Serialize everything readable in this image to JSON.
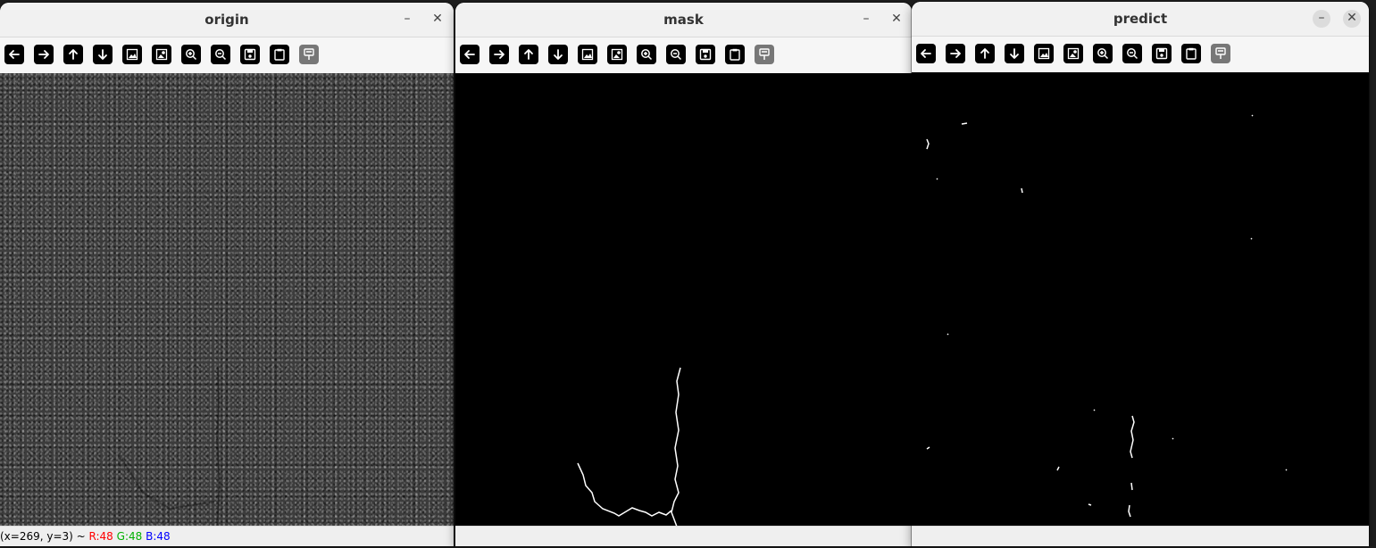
{
  "windows": [
    {
      "title": "origin",
      "status": {
        "coords": "(x=269, y=3) ~ ",
        "r": "R:48",
        "g": "G:48",
        "b": "B:48"
      }
    },
    {
      "title": "mask"
    },
    {
      "title": "predict"
    }
  ],
  "controls": {
    "minimize": "–",
    "close": "✕"
  },
  "toolbar_icons": [
    "arrow-left-icon",
    "arrow-right-icon",
    "arrow-up-icon",
    "arrow-down-icon",
    "image-icon",
    "image-properties-icon",
    "zoom-in-icon",
    "zoom-out-icon",
    "save-icon",
    "clipboard-icon",
    "properties-icon"
  ],
  "colors": {
    "r": "#ff0000",
    "g": "#00b000",
    "b": "#0000ff"
  }
}
